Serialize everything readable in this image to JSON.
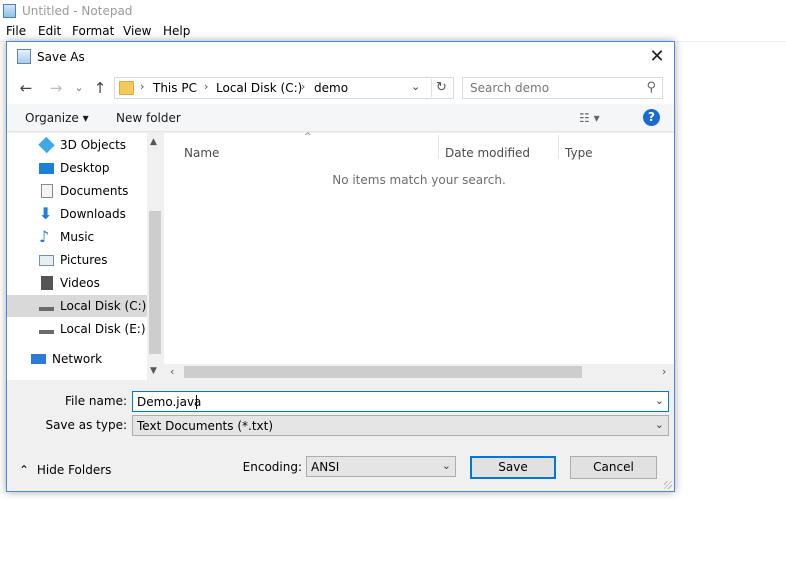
{
  "notepad": {
    "title": "Untitled - Notepad",
    "menu": [
      "File",
      "Edit",
      "Format",
      "View",
      "Help"
    ]
  },
  "dialog": {
    "title": "Save As",
    "close_glyph": "✕",
    "nav": {
      "back": "←",
      "forward": "→",
      "recent": "⌄",
      "up": "↑"
    },
    "breadcrumb": [
      "This PC",
      "Local Disk (C:)",
      "demo"
    ],
    "breadcrumb_sep": "›",
    "search_placeholder": "Search demo",
    "toolbar": {
      "organize": "Organize ▾",
      "new_folder": "New folder",
      "view_glyph": "☷ ▾",
      "help_glyph": "?"
    },
    "nav_pane": [
      {
        "label": "3D Objects",
        "icon": "cube-icon",
        "color": "#3fa9e8"
      },
      {
        "label": "Desktop",
        "icon": "desktop-icon",
        "color": "#1e7fd6"
      },
      {
        "label": "Documents",
        "icon": "documents-icon",
        "color": "#d8d8d8"
      },
      {
        "label": "Downloads",
        "icon": "download-icon",
        "color": "#1e7fd6"
      },
      {
        "label": "Music",
        "icon": "music-icon",
        "color": "#1e7fd6"
      },
      {
        "label": "Pictures",
        "icon": "pictures-icon",
        "color": "#7a8fa3"
      },
      {
        "label": "Videos",
        "icon": "videos-icon",
        "color": "#555555"
      },
      {
        "label": "Local Disk (C:)",
        "icon": "drive-icon",
        "color": "#6a6a6a",
        "selected": true
      },
      {
        "label": "Local Disk (E:)",
        "icon": "drive-icon",
        "color": "#6a6a6a"
      },
      {
        "label": "Network",
        "icon": "network-icon",
        "color": "#2b7bd4"
      }
    ],
    "columns": [
      "Name",
      "Date modified",
      "Type"
    ],
    "empty_message": "No items match your search.",
    "file_name_label": "File name:",
    "file_name_value": "Demo.java",
    "save_type_label": "Save as type:",
    "save_type_value": "Text Documents (*.txt)",
    "hide_folders": "Hide Folders",
    "encoding_label": "Encoding:",
    "encoding_value": "ANSI",
    "save_button": "Save",
    "cancel_button": "Cancel"
  },
  "colors": {
    "accent": "#0078d7",
    "dialog_border": "#4b8ad6",
    "folder": "#f3c85c"
  }
}
